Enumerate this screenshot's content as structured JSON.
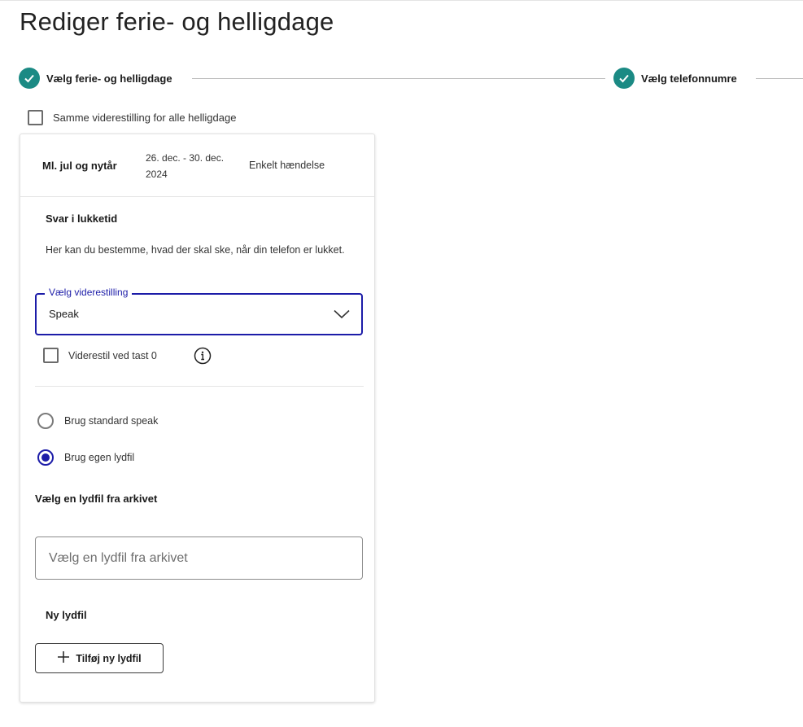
{
  "page": {
    "title": "Rediger ferie- og helligdage"
  },
  "stepper": {
    "steps": [
      {
        "label": "Vælg ferie- og helligdage",
        "status": "completed"
      },
      {
        "label": "Vælg telefonnumre",
        "status": "completed"
      }
    ]
  },
  "same_forward": {
    "label": "Samme viderestilling for alle helligdage",
    "checked": false
  },
  "holiday": {
    "name": "Ml. jul og nytår",
    "dates": "26. dec. - 30. dec. 2024",
    "type": "Enkelt hændelse"
  },
  "closed": {
    "title": "Svar i lukketid",
    "description": "Her kan du bestemme, hvad der skal ske, når din telefon er lukket.",
    "select": {
      "legend": "Vælg viderestilling",
      "value": "Speak"
    },
    "forward_key": {
      "label": "Viderestil ved tast 0",
      "checked": false
    }
  },
  "speak_options": [
    {
      "label": "Brug standard speak",
      "selected": false
    },
    {
      "label": "Brug egen lydfil",
      "selected": true
    }
  ],
  "archive": {
    "title": "Vælg en lydfil fra arkivet",
    "placeholder": "Vælg en lydfil fra arkivet"
  },
  "new_file": {
    "title": "Ny lydfil",
    "button_label": "Tilføj ny lydfil"
  },
  "colors": {
    "accent": "#1c1ca8",
    "step_done": "#1b8a84"
  },
  "icons": [
    "check-icon",
    "chevron-down-icon",
    "info-icon",
    "plus-icon"
  ]
}
